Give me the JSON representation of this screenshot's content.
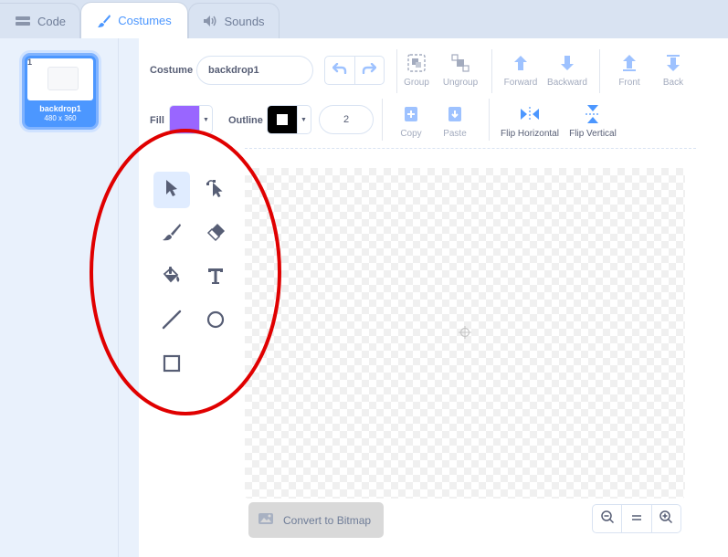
{
  "tabs": [
    {
      "label": "Code",
      "icon": "code-icon"
    },
    {
      "label": "Costumes",
      "icon": "brush-icon"
    },
    {
      "label": "Sounds",
      "icon": "speaker-icon"
    }
  ],
  "costume_list": [
    {
      "number": "1",
      "name": "backdrop1",
      "size": "480 x 360"
    }
  ],
  "toolbar": {
    "costume_label": "Costume",
    "costume_name": "backdrop1",
    "group": "Group",
    "ungroup": "Ungroup",
    "forward": "Forward",
    "backward": "Backward",
    "front": "Front",
    "back": "Back",
    "fill_label": "Fill",
    "fill_color": "#9966ff",
    "outline_label": "Outline",
    "outline_color": "#000000",
    "outline_width": "2",
    "copy": "Copy",
    "paste": "Paste",
    "flip_horizontal": "Flip Horizontal",
    "flip_vertical": "Flip Vertical"
  },
  "tools": [
    "select",
    "reshape",
    "brush",
    "eraser",
    "fill",
    "text",
    "line",
    "circle",
    "rectangle"
  ],
  "active_tool": "select",
  "bottom": {
    "convert_label": "Convert to Bitmap"
  },
  "colors": {
    "accent": "#4c97ff",
    "annotation": "#e00000"
  }
}
